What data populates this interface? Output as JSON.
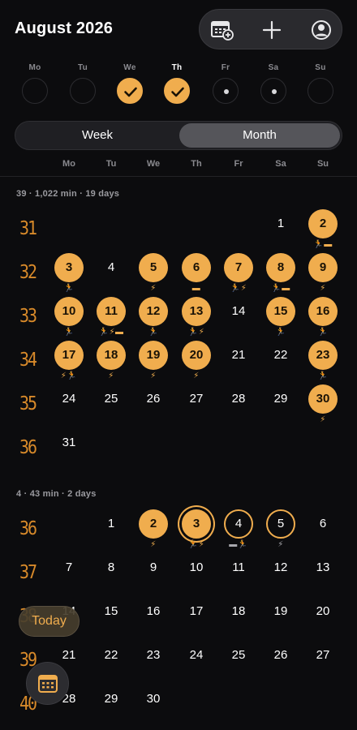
{
  "header": {
    "title": "August 2026",
    "actions": [
      {
        "name": "calendar-add-icon"
      },
      {
        "name": "plus-icon"
      },
      {
        "name": "profile-icon"
      }
    ]
  },
  "week_strip": [
    {
      "label": "Mo",
      "state": "empty"
    },
    {
      "label": "Tu",
      "state": "empty"
    },
    {
      "label": "We",
      "state": "done"
    },
    {
      "label": "Th",
      "state": "done",
      "today": true
    },
    {
      "label": "Fr",
      "state": "dot"
    },
    {
      "label": "Sa",
      "state": "dot"
    },
    {
      "label": "Su",
      "state": "empty"
    }
  ],
  "segment": {
    "week_label": "Week",
    "month_label": "Month",
    "selected": "Month"
  },
  "dow_headers": [
    "Mo",
    "Tu",
    "We",
    "Th",
    "Fr",
    "Sa",
    "Su"
  ],
  "months": [
    {
      "summary": "39 · 1,022 min · 19 days",
      "weeks": [
        {
          "num": "31",
          "days": [
            null,
            null,
            null,
            null,
            null,
            {
              "d": "1"
            },
            {
              "d": "2",
              "style": "filled",
              "icons": "🏃▬"
            }
          ]
        },
        {
          "num": "32",
          "days": [
            {
              "d": "3",
              "style": "filled",
              "icons": "🏃"
            },
            {
              "d": "4"
            },
            {
              "d": "5",
              "style": "filled",
              "icons": "⚡"
            },
            {
              "d": "6",
              "style": "filled",
              "icons": "▬"
            },
            {
              "d": "7",
              "style": "filled",
              "icons": "🏃⚡"
            },
            {
              "d": "8",
              "style": "filled",
              "icons": "🏃▬"
            },
            {
              "d": "9",
              "style": "filled",
              "icons": "⚡"
            }
          ]
        },
        {
          "num": "33",
          "days": [
            {
              "d": "10",
              "style": "filled",
              "icons": "🏃"
            },
            {
              "d": "11",
              "style": "filled",
              "icons": "🏃⚡▬"
            },
            {
              "d": "12",
              "style": "filled",
              "icons": "🏃"
            },
            {
              "d": "13",
              "style": "filled",
              "icons": "🏃⚡"
            },
            {
              "d": "14"
            },
            {
              "d": "15",
              "style": "filled",
              "icons": "🏃"
            },
            {
              "d": "16",
              "style": "filled",
              "icons": "🏃"
            }
          ]
        },
        {
          "num": "34",
          "days": [
            {
              "d": "17",
              "style": "filled",
              "icons": "⚡🏃"
            },
            {
              "d": "18",
              "style": "filled",
              "icons": "⚡"
            },
            {
              "d": "19",
              "style": "filled",
              "icons": "⚡"
            },
            {
              "d": "20",
              "style": "filled",
              "icons": "⚡"
            },
            {
              "d": "21"
            },
            {
              "d": "22"
            },
            {
              "d": "23",
              "style": "filled",
              "icons": "🏃"
            }
          ]
        },
        {
          "num": "35",
          "days": [
            {
              "d": "24"
            },
            {
              "d": "25"
            },
            {
              "d": "26"
            },
            {
              "d": "27"
            },
            {
              "d": "28"
            },
            {
              "d": "29"
            },
            {
              "d": "30",
              "style": "filled",
              "icons": "⚡"
            }
          ]
        },
        {
          "num": "36",
          "days": [
            {
              "d": "31"
            },
            null,
            null,
            null,
            null,
            null,
            null
          ]
        }
      ]
    },
    {
      "summary": "4 · 43 min · 2 days",
      "weeks": [
        {
          "num": "36",
          "days": [
            null,
            {
              "d": "1"
            },
            {
              "d": "2",
              "style": "filled",
              "icons": "⚡"
            },
            {
              "d": "3",
              "style": "ring-double",
              "icons": "🏃⚡"
            },
            {
              "d": "4",
              "style": "ring",
              "icons": "▬🏃",
              "grey": true
            },
            {
              "d": "5",
              "style": "ring",
              "icons": "⚡",
              "grey": true
            },
            {
              "d": "6"
            }
          ]
        },
        {
          "num": "37",
          "days": [
            {
              "d": "7"
            },
            {
              "d": "8"
            },
            {
              "d": "9"
            },
            {
              "d": "10"
            },
            {
              "d": "11"
            },
            {
              "d": "12"
            },
            {
              "d": "13"
            }
          ]
        },
        {
          "num": "38",
          "days": [
            {
              "d": "14"
            },
            {
              "d": "15"
            },
            {
              "d": "16"
            },
            {
              "d": "17"
            },
            {
              "d": "18"
            },
            {
              "d": "19"
            },
            {
              "d": "20"
            }
          ]
        },
        {
          "num": "39",
          "days": [
            {
              "d": "21"
            },
            {
              "d": "22"
            },
            {
              "d": "23"
            },
            {
              "d": "24"
            },
            {
              "d": "25"
            },
            {
              "d": "26"
            },
            {
              "d": "27"
            }
          ]
        },
        {
          "num": "40",
          "days": [
            {
              "d": "28"
            },
            {
              "d": "29"
            },
            {
              "d": "30"
            },
            null,
            null,
            null,
            null
          ]
        }
      ]
    }
  ],
  "floating": {
    "today_label": "Today",
    "calendar_icon": "calendar-grid-icon"
  },
  "colors": {
    "accent": "#f0ad4e",
    "background": "#0c0c0e",
    "week_number": "#d88a2a"
  }
}
